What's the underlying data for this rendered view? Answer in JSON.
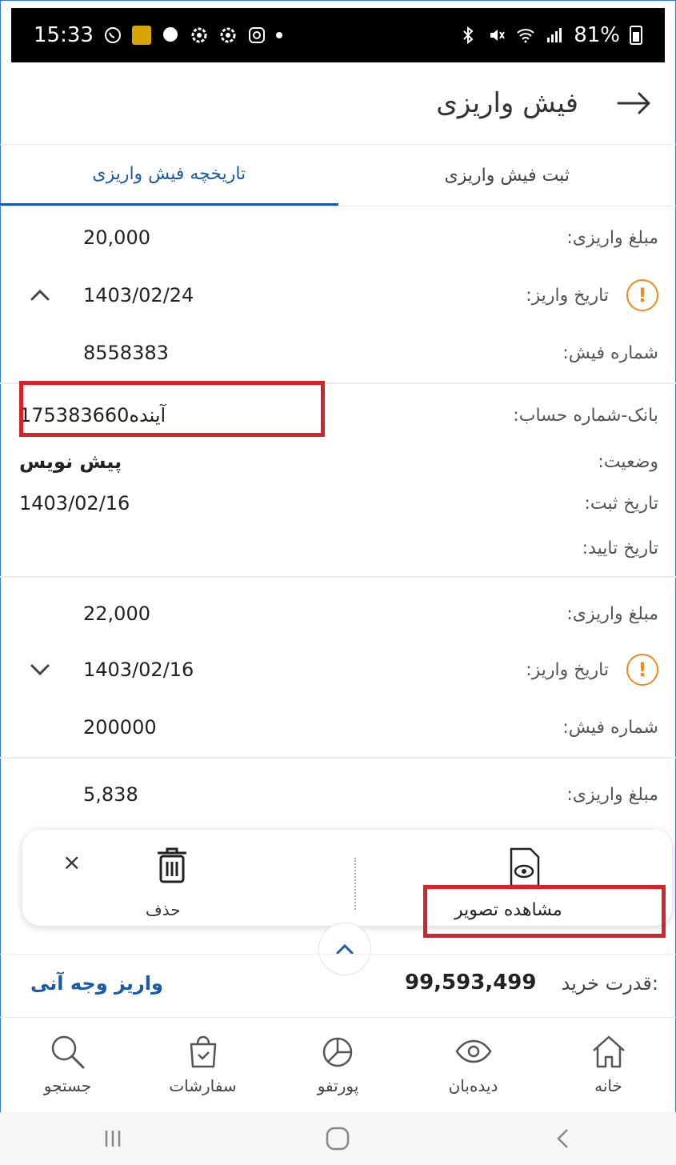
{
  "status_bar": {
    "time": "15:33",
    "battery": "81%"
  },
  "header": {
    "title": "فیش واریزی"
  },
  "tabs": [
    {
      "label": "ثبت فیش واریزی",
      "active": false
    },
    {
      "label": "تاریخچه فیش واریزی",
      "active": true
    }
  ],
  "receipts": [
    {
      "amount_label": "مبلغ واریزی:",
      "amount": "20,000",
      "date_label": "تاریخ واریز:",
      "date": "1403/02/24",
      "number_label": "شماره فیش:",
      "number": "8558383",
      "bank_label": "بانک-شماره حساب:",
      "bank": "آینده175383660",
      "status_label": "وضعیت:",
      "status": "پیش نویس",
      "reg_label": "تاریخ ثبت:",
      "reg_date": "1403/02/16",
      "confirm_label": "تاریخ تایید:",
      "confirm_date": ""
    },
    {
      "amount_label": "مبلغ واریزی:",
      "amount": "22,000",
      "date_label": "تاریخ واریز:",
      "date": "1403/02/16",
      "number_label": "شماره فیش:",
      "number": "200000"
    },
    {
      "amount_label": "مبلغ واریزی:",
      "amount": "5,838"
    }
  ],
  "actions": {
    "view_label": "مشاهده تصویر",
    "delete_label": "حذف",
    "close": "×"
  },
  "info": {
    "power_label": "قدرت خرید:",
    "power_value": "99,593,499",
    "instant_deposit": "واریز وجه آنی"
  },
  "nav": [
    {
      "label": "خانه",
      "icon": "home-icon"
    },
    {
      "label": "دیده‌بان",
      "icon": "eye-icon"
    },
    {
      "label": "پورتفو",
      "icon": "pie-chart-icon"
    },
    {
      "label": "سفارشات",
      "icon": "bag-icon"
    },
    {
      "label": "جستجو",
      "icon": "search-icon"
    }
  ],
  "colors": {
    "accent": "#1b5aa8",
    "warning": "#f08a1a",
    "highlight": "#d4232a"
  }
}
